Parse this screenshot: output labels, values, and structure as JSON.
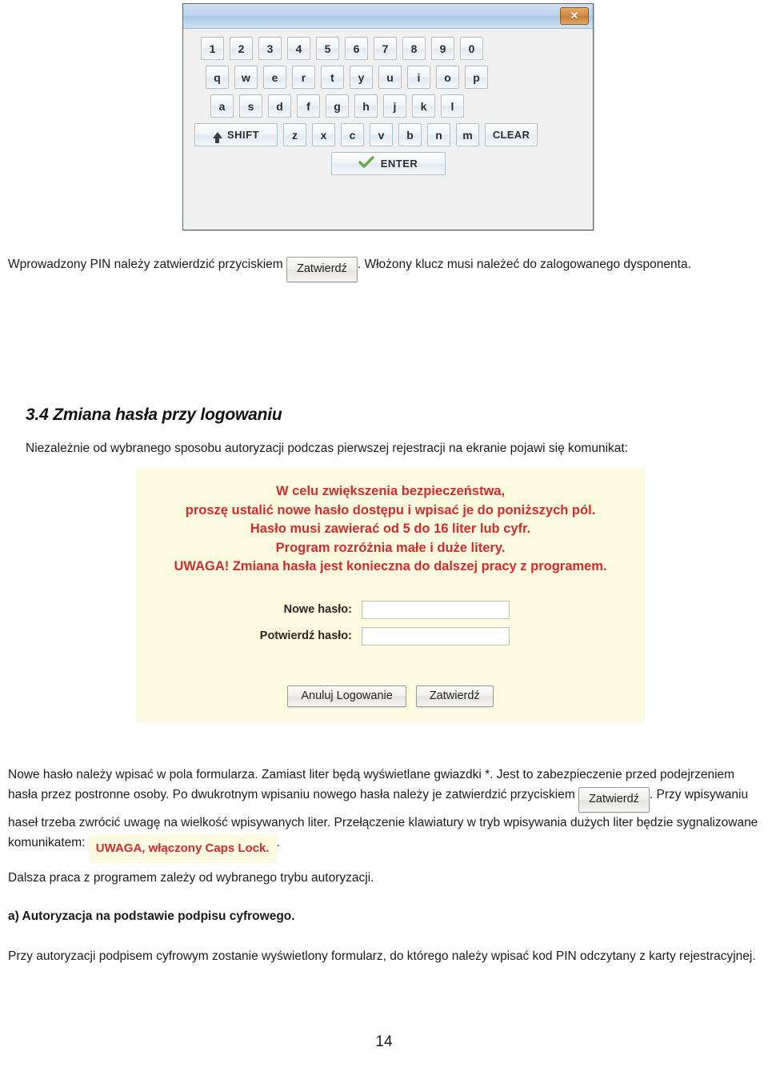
{
  "keyboard_dialog": {
    "close_button_label": "✕",
    "rows": [
      {
        "id": "digits",
        "keys": [
          "1",
          "2",
          "3",
          "4",
          "5",
          "6",
          "7",
          "8",
          "9",
          "0"
        ]
      },
      {
        "id": "top-letters",
        "keys": [
          "q",
          "w",
          "e",
          "r",
          "t",
          "y",
          "u",
          "i",
          "o",
          "p"
        ]
      },
      {
        "id": "home-letters",
        "keys": [
          "a",
          "s",
          "d",
          "f",
          "g",
          "h",
          "j",
          "k",
          "l"
        ]
      },
      {
        "id": "bottom-letters",
        "keys": [
          "z",
          "x",
          "c",
          "v",
          "b",
          "n",
          "m"
        ]
      }
    ],
    "shift_label": "SHIFT",
    "clear_label": "CLEAR",
    "enter_label": "ENTER"
  },
  "body": {
    "p1_before": "Wprowadzony PIN należy zatwierdzić przyciskiem",
    "p1_button": "Zatwierdź",
    "p1_after": ". Włożony klucz musi należeć do zalogowanego dysponenta.",
    "heading": "3.4 Zmiana hasła przy logowaniu",
    "p2": "Niezależnie od wybranego sposobu autoryzacji podczas pierwszej rejestracji na ekranie pojawi się komunikat:",
    "p3_before": "Nowe hasło należy wpisać w pola formularza. Zamiast liter będą wyświetlane gwiazdki *. Jest to zabezpieczenie przed podejrzeniem hasła przez postronne osoby. Po dwukrotnym wpisaniu nowego hasła należy je zatwierdzić przyciskiem",
    "p3_button": "Zatwierdź",
    "p3_after": ". Przy wpisywaniu haseł trzeba zwrócić uwagę na wielkość wpisywanych liter. Przełączenie klawiatury w tryb wpisywania dużych liter będzie sygnalizowane komunikatem:",
    "caps_lock_badge": "UWAGA, włączony Caps Lock.",
    "p3_tail": ".",
    "p4": "Dalsza praca z programem zależy od wybranego trybu autoryzacji.",
    "p5_bold": "a) Autoryzacja na podstawie podpisu cyfrowego.",
    "p6": "Przy autoryzacji podpisem cyfrowym zostanie wyświetlony formularz, do którego należy wpisać kod PIN odczytany z karty rejestracyjnej."
  },
  "password_dialog": {
    "message_lines": [
      "W celu zwiększenia bezpieczeństwa,",
      "proszę ustalić nowe hasło dostępu i wpisać je do poniższych pól.",
      "Hasło musi zawierać od 5 do 16 liter lub cyfr.",
      "Program rozróżnia małe i duże litery.",
      "UWAGA! Zmiana hasła jest konieczna do dalszej pracy z programem."
    ],
    "new_password_label": "Nowe hasło:",
    "new_password_value": "",
    "confirm_password_label": "Potwierdź hasło:",
    "confirm_password_value": "",
    "cancel_button": "Anuluj Logowanie",
    "confirm_button": "Zatwierdź"
  },
  "footer": {
    "page_number": "14"
  },
  "colors": {
    "dialog_yellow": "#fcfbe0",
    "warning_red": "#d42a2a",
    "titlebar_blue": "#bcd4ec",
    "close_orange": "#d08b44"
  }
}
